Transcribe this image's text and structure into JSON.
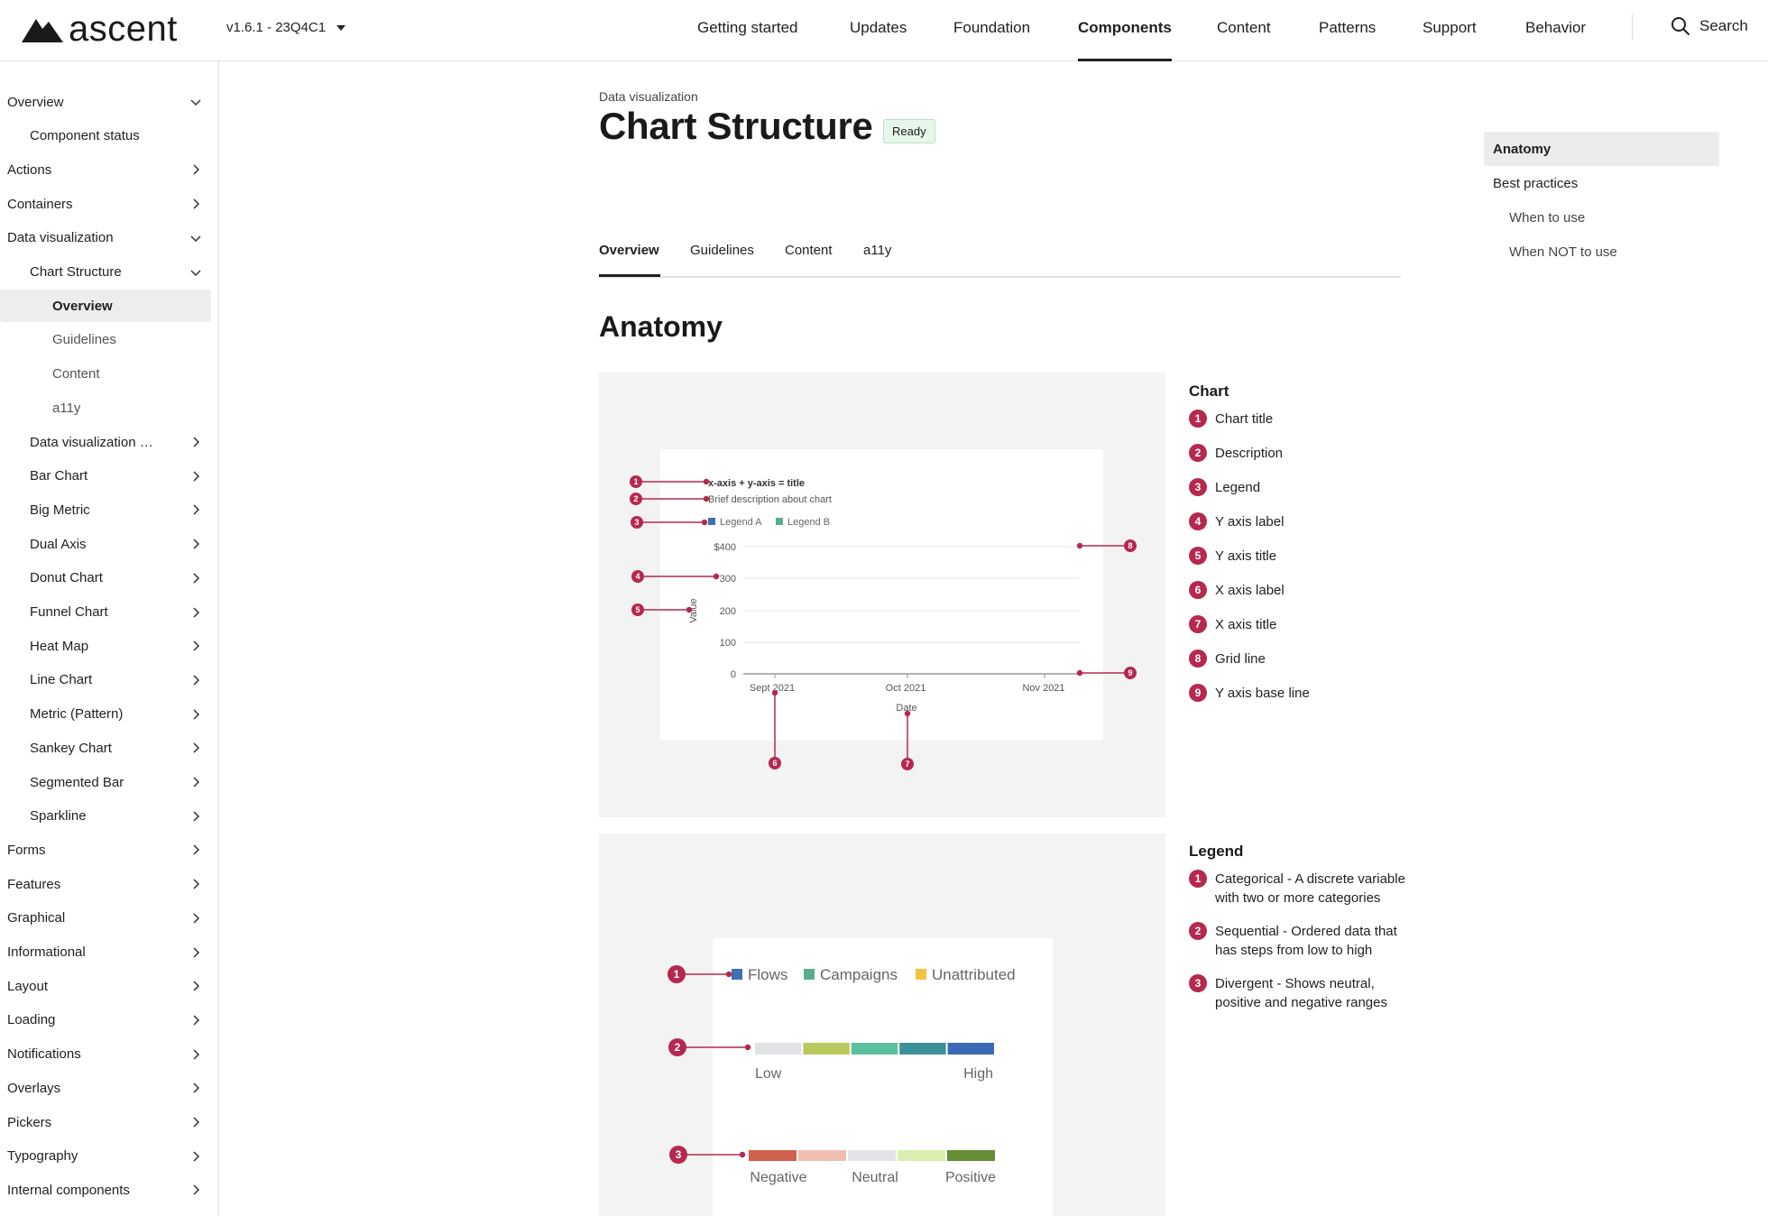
{
  "header": {
    "logo_text": "ascent",
    "version": "v1.6.1 - 23Q4C1",
    "nav": [
      "Getting started",
      "Updates",
      "Foundation",
      "Components",
      "Content",
      "Patterns",
      "Support",
      "Behavior"
    ],
    "active_nav": "Components",
    "search_label": "Search"
  },
  "sidebar": {
    "items": [
      {
        "label": "Overview",
        "level": 0,
        "chevron": "down"
      },
      {
        "label": "Component status",
        "level": 1,
        "chevron": ""
      },
      {
        "label": "Actions",
        "level": 0,
        "chevron": "right"
      },
      {
        "label": "Containers",
        "level": 0,
        "chevron": "right"
      },
      {
        "label": "Data visualization",
        "level": 0,
        "chevron": "down"
      },
      {
        "label": "Chart Structure",
        "level": 1,
        "chevron": "down"
      },
      {
        "label": "Overview",
        "level": 2,
        "chevron": "",
        "selected": true
      },
      {
        "label": "Guidelines",
        "level": 2,
        "chevron": ""
      },
      {
        "label": "Content",
        "level": 2,
        "chevron": ""
      },
      {
        "label": "a11y",
        "level": 2,
        "chevron": ""
      },
      {
        "label": "Data visualization colors",
        "level": 1,
        "chevron": "right"
      },
      {
        "label": "Bar Chart",
        "level": 1,
        "chevron": "right"
      },
      {
        "label": "Big Metric",
        "level": 1,
        "chevron": "right"
      },
      {
        "label": "Dual Axis",
        "level": 1,
        "chevron": "right"
      },
      {
        "label": "Donut Chart",
        "level": 1,
        "chevron": "right"
      },
      {
        "label": "Funnel Chart",
        "level": 1,
        "chevron": "right"
      },
      {
        "label": "Heat Map",
        "level": 1,
        "chevron": "right"
      },
      {
        "label": "Line Chart",
        "level": 1,
        "chevron": "right"
      },
      {
        "label": "Metric (Pattern)",
        "level": 1,
        "chevron": "right"
      },
      {
        "label": "Sankey Chart",
        "level": 1,
        "chevron": "right"
      },
      {
        "label": "Segmented Bar",
        "level": 1,
        "chevron": "right"
      },
      {
        "label": "Sparkline",
        "level": 1,
        "chevron": "right"
      },
      {
        "label": "Forms",
        "level": 0,
        "chevron": "right"
      },
      {
        "label": "Features",
        "level": 0,
        "chevron": "right"
      },
      {
        "label": "Graphical",
        "level": 0,
        "chevron": "right"
      },
      {
        "label": "Informational",
        "level": 0,
        "chevron": "right"
      },
      {
        "label": "Layout",
        "level": 0,
        "chevron": "right"
      },
      {
        "label": "Loading",
        "level": 0,
        "chevron": "right"
      },
      {
        "label": "Notifications",
        "level": 0,
        "chevron": "right"
      },
      {
        "label": "Overlays",
        "level": 0,
        "chevron": "right"
      },
      {
        "label": "Pickers",
        "level": 0,
        "chevron": "right"
      },
      {
        "label": "Typography",
        "level": 0,
        "chevron": "right"
      },
      {
        "label": "Internal components",
        "level": 0,
        "chevron": "right"
      }
    ]
  },
  "main": {
    "breadcrumb": "Data visualization",
    "title": "Chart Structure",
    "status_badge": "Ready",
    "tabs": [
      "Overview",
      "Guidelines",
      "Content",
      "a11y"
    ],
    "active_tab": "Overview",
    "section_title": "Anatomy"
  },
  "anatomy_chart": {
    "title": "x-axis + y-axis = title",
    "description": "Brief description about chart",
    "legend": [
      {
        "label": "Legend A",
        "color": "#3f6fb4"
      },
      {
        "label": "Legend B",
        "color": "#5aad8c"
      }
    ],
    "y_ticks": [
      "$400",
      "300",
      "200",
      "100",
      "0"
    ],
    "y_title": "Value",
    "x_ticks": [
      "Sept 2021",
      "Oct 2021",
      "Nov 2021"
    ],
    "x_title": "Date"
  },
  "chart_annotations": {
    "heading": "Chart",
    "items": [
      "Chart title",
      "Description",
      "Legend",
      "Y axis label",
      "Y axis title",
      "X axis label",
      "X axis title",
      "Grid line",
      "Y axis base line"
    ]
  },
  "legend_example": {
    "categorical": [
      {
        "label": "Flows",
        "color": "#3f6fb4"
      },
      {
        "label": "Campaigns",
        "color": "#5aad8c"
      },
      {
        "label": "Unattributed",
        "color": "#f0c43f"
      }
    ],
    "sequential_colors": [
      "#e1e3e6",
      "#b9c95e",
      "#5cbf9d",
      "#3c9199",
      "#3a69b5"
    ],
    "sequential_labels": [
      "Low",
      "High"
    ],
    "divergent_colors": [
      "#d0614e",
      "#f1bfb2",
      "#e1e3e6",
      "#dbf0b0",
      "#658e35"
    ],
    "divergent_labels": [
      "Negative",
      "Neutral",
      "Positive"
    ]
  },
  "legend_annotations": {
    "heading": "Legend",
    "items": [
      "Categorical - A discrete variable with two or more categories",
      "Sequential - Ordered data that has steps from low to high",
      "Divergent - Shows neutral, positive and negative ranges"
    ]
  },
  "toc": {
    "items": [
      {
        "label": "Anatomy",
        "level": 0,
        "selected": true
      },
      {
        "label": "Best practices",
        "level": 0
      },
      {
        "label": "When to use",
        "level": 1
      },
      {
        "label": "When NOT to use",
        "level": 1
      }
    ]
  },
  "colors": {
    "accent": "#b5294e",
    "panel_bg": "#f3f3f3",
    "badge_bg": "#e6f6ea"
  }
}
